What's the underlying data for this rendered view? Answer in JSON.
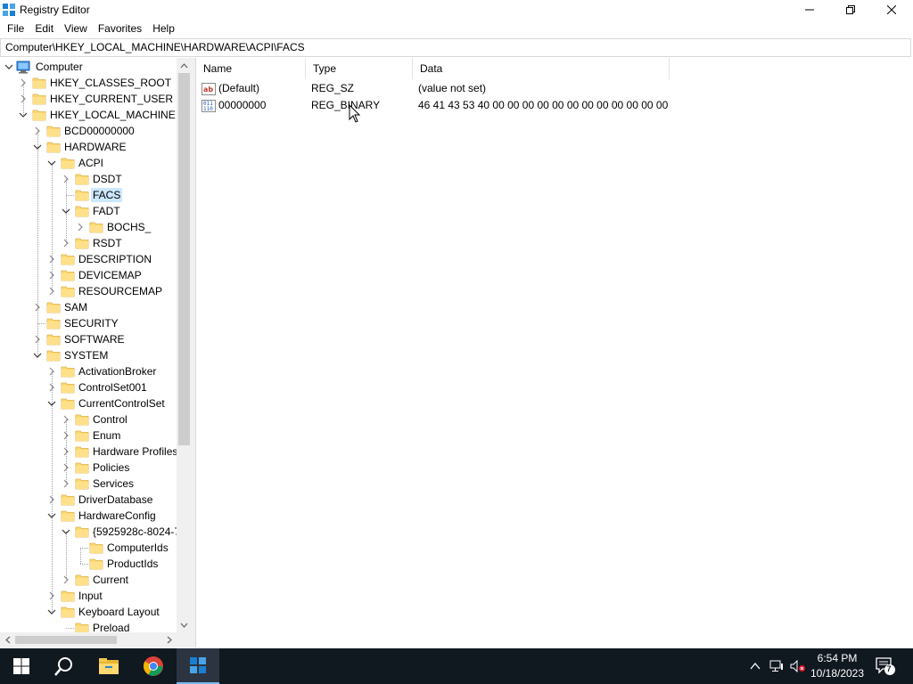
{
  "window": {
    "title": "Registry Editor"
  },
  "menu": [
    "File",
    "Edit",
    "View",
    "Favorites",
    "Help"
  ],
  "address": "Computer\\HKEY_LOCAL_MACHINE\\HARDWARE\\ACPI\\FACS",
  "tree": [
    {
      "label": "Computer",
      "level": 0,
      "expander": "expanded",
      "icon": "computer-icon"
    },
    {
      "label": "HKEY_CLASSES_ROOT",
      "level": 1,
      "expander": "collapsed"
    },
    {
      "label": "HKEY_CURRENT_USER",
      "level": 1,
      "expander": "collapsed"
    },
    {
      "label": "HKEY_LOCAL_MACHINE",
      "level": 1,
      "expander": "expanded"
    },
    {
      "label": "BCD00000000",
      "level": 2,
      "expander": "collapsed"
    },
    {
      "label": "HARDWARE",
      "level": 2,
      "expander": "expanded"
    },
    {
      "label": "ACPI",
      "level": 3,
      "expander": "expanded"
    },
    {
      "label": "DSDT",
      "level": 4,
      "expander": "collapsed"
    },
    {
      "label": "FACS",
      "level": 4,
      "expander": "none",
      "selected": true
    },
    {
      "label": "FADT",
      "level": 4,
      "expander": "expanded"
    },
    {
      "label": "BOCHS_",
      "level": 5,
      "expander": "collapsed"
    },
    {
      "label": "RSDT",
      "level": 4,
      "expander": "collapsed"
    },
    {
      "label": "DESCRIPTION",
      "level": 3,
      "expander": "collapsed"
    },
    {
      "label": "DEVICEMAP",
      "level": 3,
      "expander": "collapsed"
    },
    {
      "label": "RESOURCEMAP",
      "level": 3,
      "expander": "collapsed"
    },
    {
      "label": "SAM",
      "level": 2,
      "expander": "collapsed"
    },
    {
      "label": "SECURITY",
      "level": 2,
      "expander": "none"
    },
    {
      "label": "SOFTWARE",
      "level": 2,
      "expander": "collapsed"
    },
    {
      "label": "SYSTEM",
      "level": 2,
      "expander": "expanded"
    },
    {
      "label": "ActivationBroker",
      "level": 3,
      "expander": "collapsed"
    },
    {
      "label": "ControlSet001",
      "level": 3,
      "expander": "collapsed"
    },
    {
      "label": "CurrentControlSet",
      "level": 3,
      "expander": "expanded"
    },
    {
      "label": "Control",
      "level": 4,
      "expander": "collapsed"
    },
    {
      "label": "Enum",
      "level": 4,
      "expander": "collapsed"
    },
    {
      "label": "Hardware Profiles",
      "level": 4,
      "expander": "collapsed"
    },
    {
      "label": "Policies",
      "level": 4,
      "expander": "collapsed"
    },
    {
      "label": "Services",
      "level": 4,
      "expander": "collapsed"
    },
    {
      "label": "DriverDatabase",
      "level": 3,
      "expander": "collapsed"
    },
    {
      "label": "HardwareConfig",
      "level": 3,
      "expander": "expanded"
    },
    {
      "label": "{5925928c-8024-7",
      "level": 4,
      "expander": "expanded"
    },
    {
      "label": "ComputerIds",
      "level": 5,
      "expander": "none"
    },
    {
      "label": "ProductIds",
      "level": 5,
      "expander": "none"
    },
    {
      "label": "Current",
      "level": 4,
      "expander": "collapsed"
    },
    {
      "label": "Input",
      "level": 3,
      "expander": "collapsed"
    },
    {
      "label": "Keyboard Layout",
      "level": 3,
      "expander": "expanded"
    },
    {
      "label": "Preload",
      "level": 4,
      "expander": "none"
    }
  ],
  "list": {
    "columns": [
      "Name",
      "Type",
      "Data"
    ],
    "rows": [
      {
        "name": "(Default)",
        "type": "REG_SZ",
        "data": "(value not set)",
        "icon": "string-value-icon"
      },
      {
        "name": "00000000",
        "type": "REG_BINARY",
        "data": "46 41 43 53 40 00 00 00 00 00 00 00 00 00 00 00 00 00 00 00 00...",
        "icon": "binary-value-icon"
      }
    ]
  },
  "taskbar": {
    "time": "6:54 PM",
    "date": "10/18/2023",
    "notification_count": "7"
  },
  "colors": {
    "selection": "#cce8ff",
    "taskbar": "#101820",
    "folder": "#ffd970",
    "accent": "#0078d7"
  }
}
